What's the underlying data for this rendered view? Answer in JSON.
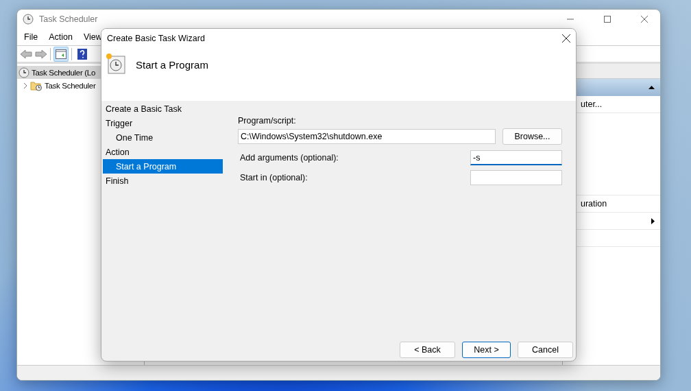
{
  "main_window": {
    "title": "Task Scheduler",
    "menu": [
      "File",
      "Action",
      "View"
    ],
    "tree": [
      {
        "label": "Task Scheduler (Lo",
        "selected": true,
        "children": [
          {
            "label": "Task Scheduler",
            "expanded": false
          }
        ]
      }
    ],
    "actions_pane": [
      {
        "kind": "text",
        "label": "uter..."
      },
      {
        "kind": "text",
        "label": "uration"
      },
      {
        "kind": "submenu"
      }
    ]
  },
  "wizard": {
    "title": "Create Basic Task Wizard",
    "heading": "Start a Program",
    "steps": [
      {
        "label": "Create a Basic Task",
        "selected": false
      },
      {
        "label": "Trigger",
        "selected": false,
        "children": [
          {
            "label": "One Time",
            "selected": false
          }
        ]
      },
      {
        "label": "Action",
        "selected": false,
        "children": [
          {
            "label": "Start a Program",
            "selected": true
          }
        ]
      },
      {
        "label": "Finish",
        "selected": false
      }
    ],
    "program_label": "Program/script:",
    "program_value": "C:\\Windows\\System32\\shutdown.exe",
    "browse_button": "Browse...",
    "arguments_label": "Add arguments (optional):",
    "arguments_value": "-s",
    "arguments_focused": true,
    "start_in_label": "Start in (optional):",
    "buttons": [
      {
        "label": "< Back",
        "default": false
      },
      {
        "label": "Next >",
        "default": true
      },
      {
        "label": "Cancel",
        "default": false
      }
    ]
  }
}
